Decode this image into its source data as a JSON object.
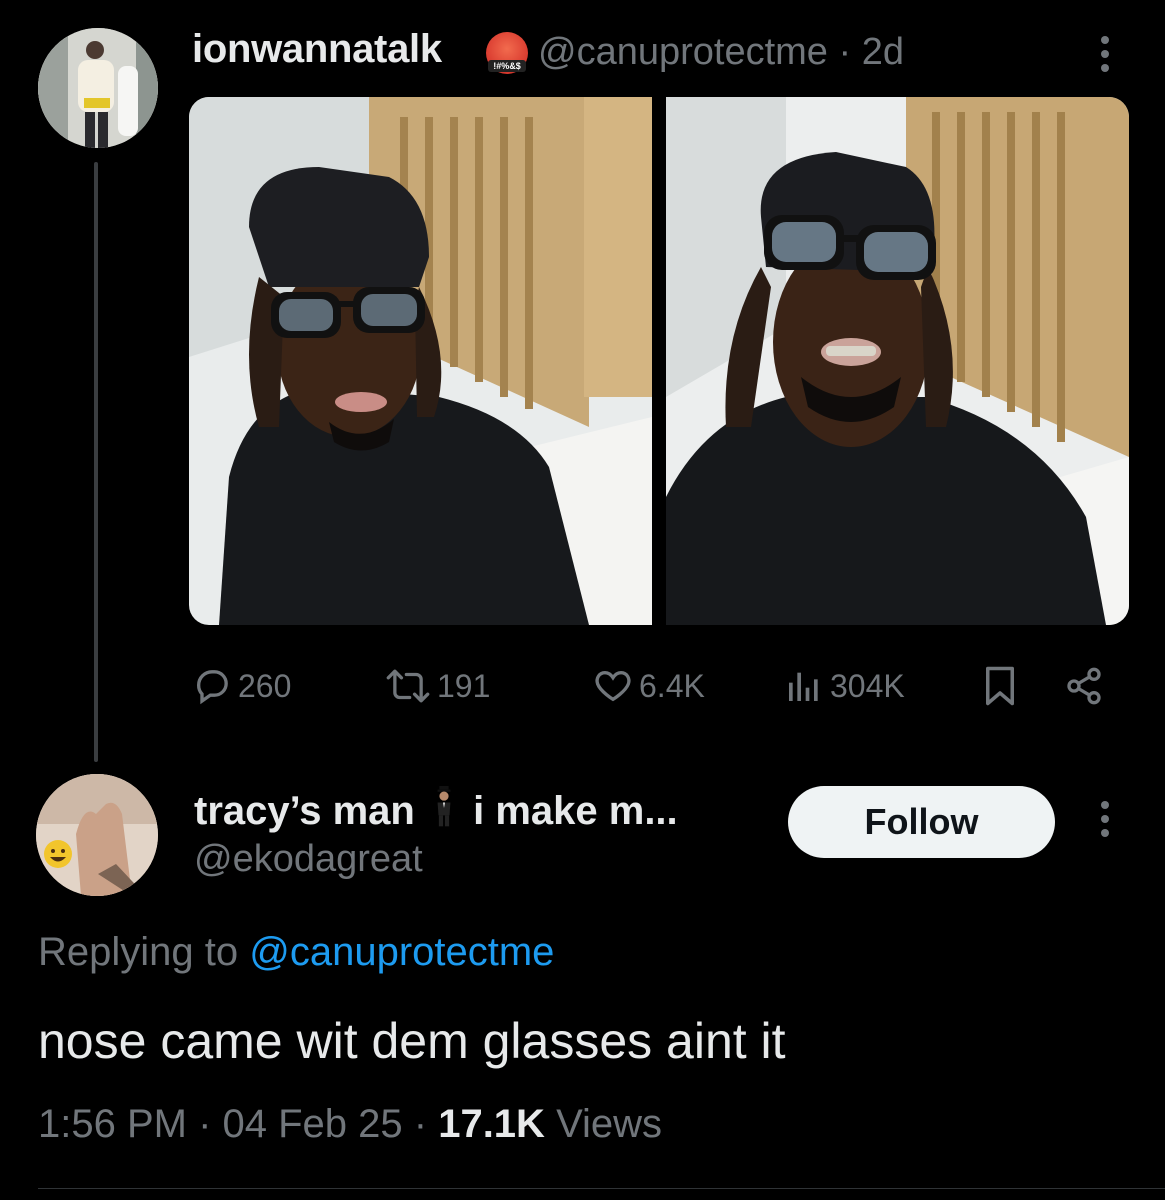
{
  "tweet": {
    "display_name": "ionwannatalk",
    "name_emoji": "face-with-symbols-on-mouth-icon",
    "emoji_symbols": "!#%&$",
    "handle": "@canuprotectme",
    "time_sep": " · ",
    "age": "2d",
    "actions": {
      "replies": "260",
      "retweets": "191",
      "likes": "6.4K",
      "views": "304K"
    }
  },
  "reply": {
    "display_name_part1": "tracy’s man",
    "name_emoji": "person-in-suit-levitating-icon",
    "display_name_part2": "i make m...",
    "handle": "@ekodagreat",
    "follow_label": "Follow",
    "replying_prefix": "Replying to ",
    "replying_handle": "@canuprotectme",
    "text": "nose came wit dem glasses aint it",
    "time": "1:56 PM",
    "sep1": " · ",
    "date": "04 Feb 25",
    "sep2": " · ",
    "views_count": "17.1K",
    "views_label": " Views"
  },
  "colors": {
    "background": "#000000",
    "primary_text": "#e7e9ea",
    "secondary_text": "#71767b",
    "link": "#1d9bf0",
    "follow_bg": "#eff3f4"
  }
}
